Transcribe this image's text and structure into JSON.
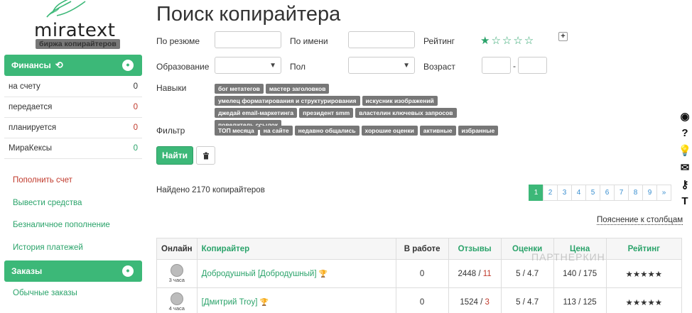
{
  "logo": {
    "brand": "miratext",
    "tagline": "биржа копирайтеров"
  },
  "sidebar": {
    "finance_title": "Финансы",
    "finance_rows": [
      {
        "label": "на счету",
        "value": "0"
      },
      {
        "label": "передается",
        "value": "0"
      },
      {
        "label": "планируется",
        "value": "0"
      },
      {
        "label": "МираКексы",
        "value": "0"
      }
    ],
    "links": [
      "Пополнить счет",
      "Вывести средства",
      "Безналичное пополнение",
      "История платежей"
    ],
    "orders_title": "Заказы",
    "orders_links": [
      "Обычные заказы"
    ]
  },
  "main": {
    "title": "Поиск копирайтера",
    "filters": {
      "by_resume": "По резюме",
      "by_name": "По имени",
      "rating": "Рейтинг",
      "education": "Образование",
      "gender": "Пол",
      "age": "Возраст",
      "age_sep": "-",
      "skills": "Навыки",
      "filter": "Фильтр"
    },
    "skill_tags": [
      "бог метатегов",
      "мастер заголовков",
      "умелец форматирования и структурирования",
      "искусник изображений",
      "джедай email-маркетинга",
      "президент smm",
      "властелин ключевых запросов",
      "повелитель ссылок"
    ],
    "filter_tags": [
      "ТОП месяца",
      "на сайте",
      "недавно общались",
      "хорошие оценки",
      "активные",
      "избранные"
    ],
    "find_button": "Найти",
    "found_text": "Найдено 2170 копирайтеров",
    "explain_link": "Пояснение к столбцам",
    "pager": [
      "1",
      "2",
      "3",
      "4",
      "5",
      "6",
      "7",
      "8",
      "9",
      "»"
    ],
    "table": {
      "headers": [
        "Онлайн",
        "Копирайтер",
        "В работе",
        "Отзывы",
        "Оценки",
        "Цена",
        "Рейтинг"
      ],
      "rows": [
        {
          "ago": "3 часа",
          "name": "Добродушный [Добродушный]",
          "work": "0",
          "rev_pos": "2448",
          "rev_neg": "11",
          "marks": "5 / 4.7",
          "price": "140 / 175",
          "rating_stars": 5
        },
        {
          "ago": "4 часа",
          "name": "[Дмитрий Troy]",
          "work": "0",
          "rev_pos": "1524",
          "rev_neg": "3",
          "marks": "5 / 4.7",
          "price": "113 / 125",
          "rating_stars": 5
        }
      ]
    },
    "watermark": "ПАРТНЕРКИН"
  },
  "colors": {
    "accent": "#3cb878",
    "link": "#2aa36a",
    "danger": "#c0392b"
  }
}
